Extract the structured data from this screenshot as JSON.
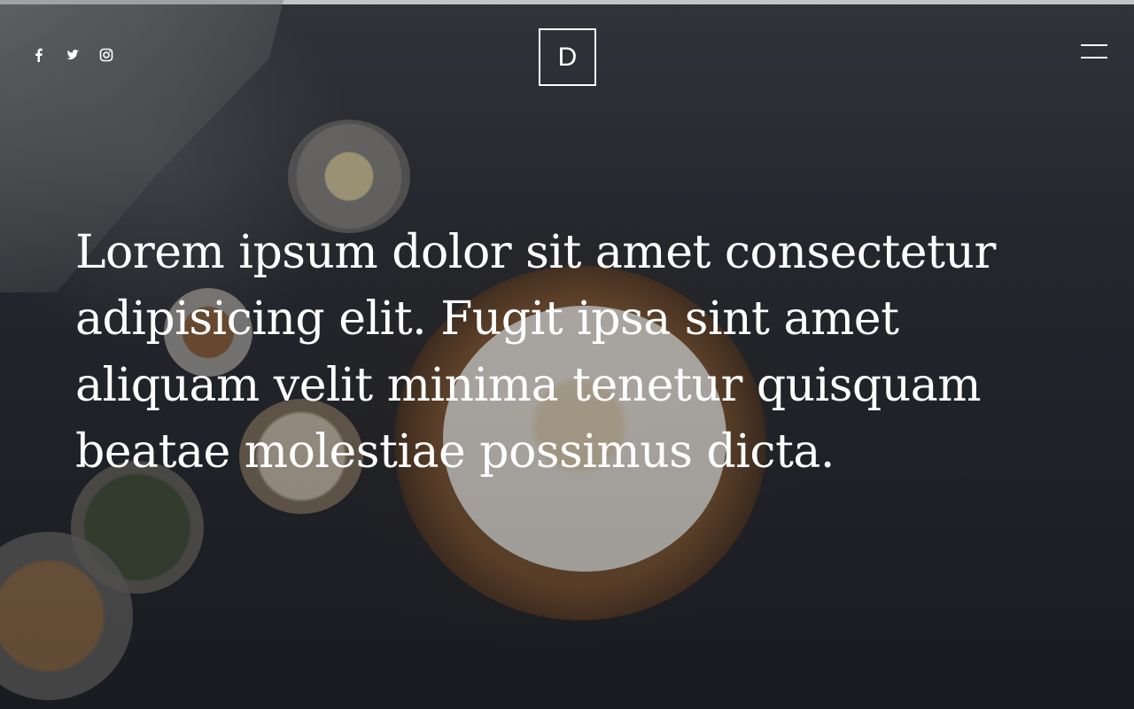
{
  "header": {
    "social": [
      {
        "name": "facebook",
        "icon": "facebook-icon"
      },
      {
        "name": "twitter",
        "icon": "twitter-icon"
      },
      {
        "name": "instagram",
        "icon": "instagram-icon"
      }
    ],
    "logo_letter": "D",
    "menu_icon": "hamburger-menu-icon"
  },
  "hero": {
    "headline": "Lorem ipsum dolor sit amet consectetur adipisicing elit. Fugit ipsa sint amet aliquam velit minima tenetur quisquam beatae molestiae possimus dicta."
  },
  "colors": {
    "text": "#ffffff",
    "top_strip": "#ffffff",
    "background": "#22252b"
  }
}
